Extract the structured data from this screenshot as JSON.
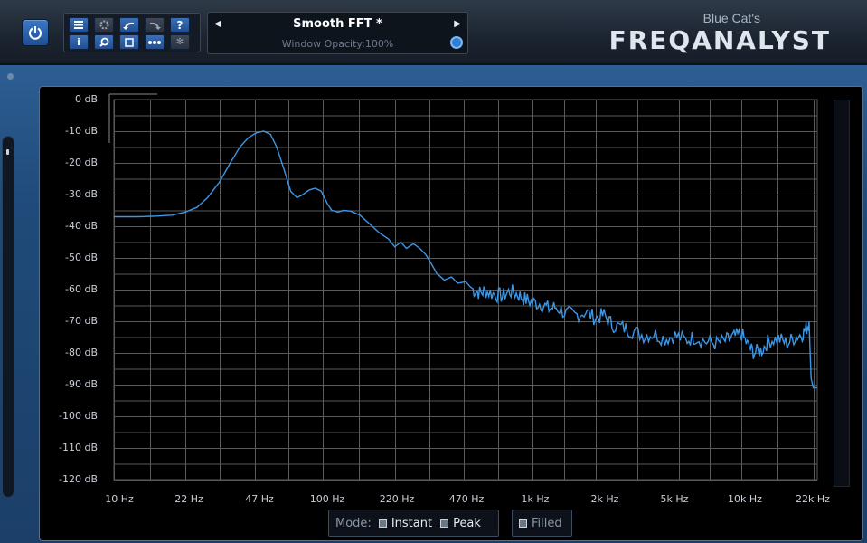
{
  "header": {
    "preset_name": "Smooth FFT *",
    "window_opacity": "Window Opacity:100%",
    "brand_small": "Blue Cat's",
    "brand_big": "FREQANALYST"
  },
  "toolbar": {
    "icons": [
      "menu-icon",
      "gear-icon",
      "undo-icon",
      "redo-icon",
      "help-icon",
      "info-icon",
      "zoom-icon",
      "window-icon",
      "dots-icon",
      "asterisk-icon"
    ]
  },
  "graph": {
    "y_labels": [
      "0 dB",
      "-10 dB",
      "-20 dB",
      "-30 dB",
      "-40 dB",
      "-50 dB",
      "-60 dB",
      "-70 dB",
      "-80 dB",
      "-90 dB",
      "-100 dB",
      "-110 dB",
      "-120 dB"
    ],
    "x_labels": [
      "10 Hz",
      "22 Hz",
      "47 Hz",
      "100 Hz",
      "220 Hz",
      "470 Hz",
      "1k Hz",
      "2k Hz",
      "5k Hz",
      "10k Hz",
      "22k Hz"
    ],
    "line_color": "#3c97e6",
    "grid_color": "#5a5a5a",
    "spectrum": [
      [
        10,
        -37
      ],
      [
        13,
        -37
      ],
      [
        16,
        -36.8
      ],
      [
        19,
        -36.5
      ],
      [
        22,
        -35.5
      ],
      [
        25,
        -34
      ],
      [
        28,
        -31
      ],
      [
        32,
        -26
      ],
      [
        36,
        -20
      ],
      [
        40,
        -15
      ],
      [
        44,
        -12
      ],
      [
        48,
        -10.5
      ],
      [
        52,
        -10
      ],
      [
        56,
        -11
      ],
      [
        60,
        -15
      ],
      [
        65,
        -22
      ],
      [
        70,
        -29
      ],
      [
        75,
        -31
      ],
      [
        80,
        -30
      ],
      [
        86,
        -28.5
      ],
      [
        92,
        -28
      ],
      [
        98,
        -29
      ],
      [
        105,
        -33
      ],
      [
        110,
        -35
      ],
      [
        118,
        -35.5
      ],
      [
        125,
        -35
      ],
      [
        135,
        -35.2
      ],
      [
        150,
        -36.5
      ],
      [
        165,
        -39
      ],
      [
        185,
        -42
      ],
      [
        205,
        -44
      ],
      [
        220,
        -46.5
      ],
      [
        235,
        -45
      ],
      [
        250,
        -47
      ],
      [
        270,
        -45.5
      ],
      [
        290,
        -47
      ],
      [
        310,
        -49
      ],
      [
        330,
        -52
      ],
      [
        350,
        -55
      ],
      [
        380,
        -57
      ],
      [
        410,
        -56
      ],
      [
        440,
        -58
      ],
      [
        480,
        -57.5
      ],
      [
        520,
        -60
      ],
      [
        560,
        -61
      ],
      [
        600,
        -60.5
      ],
      [
        660,
        -61.5
      ],
      [
        720,
        -62
      ],
      [
        780,
        -60.5
      ],
      [
        850,
        -61.5
      ],
      [
        920,
        -63
      ],
      [
        1000,
        -64
      ],
      [
        1100,
        -64.5
      ],
      [
        1200,
        -66
      ],
      [
        1300,
        -65.5
      ],
      [
        1450,
        -67.5
      ],
      [
        1600,
        -68
      ],
      [
        1800,
        -67
      ],
      [
        2000,
        -69
      ],
      [
        2200,
        -68
      ],
      [
        2400,
        -71
      ],
      [
        2700,
        -72
      ],
      [
        3000,
        -73
      ],
      [
        3400,
        -74.5
      ],
      [
        3800,
        -74
      ],
      [
        4300,
        -75.5
      ],
      [
        4800,
        -74.5
      ],
      [
        5400,
        -76
      ],
      [
        6000,
        -75
      ],
      [
        6800,
        -76.5
      ],
      [
        7600,
        -77
      ],
      [
        8500,
        -76
      ],
      [
        9200,
        -75
      ],
      [
        10000,
        -74
      ],
      [
        10800,
        -78
      ],
      [
        11500,
        -80
      ],
      [
        12500,
        -79
      ],
      [
        13500,
        -76
      ],
      [
        15000,
        -75.5
      ],
      [
        16500,
        -77
      ],
      [
        18000,
        -75
      ],
      [
        19500,
        -74
      ],
      [
        20500,
        -72
      ],
      [
        21000,
        -70
      ],
      [
        21500,
        -88
      ],
      [
        22000,
        -91
      ],
      [
        23000,
        -91
      ]
    ]
  },
  "mode": {
    "label": "Mode:",
    "instant": "Instant",
    "peak": "Peak",
    "filled": "Filled"
  }
}
